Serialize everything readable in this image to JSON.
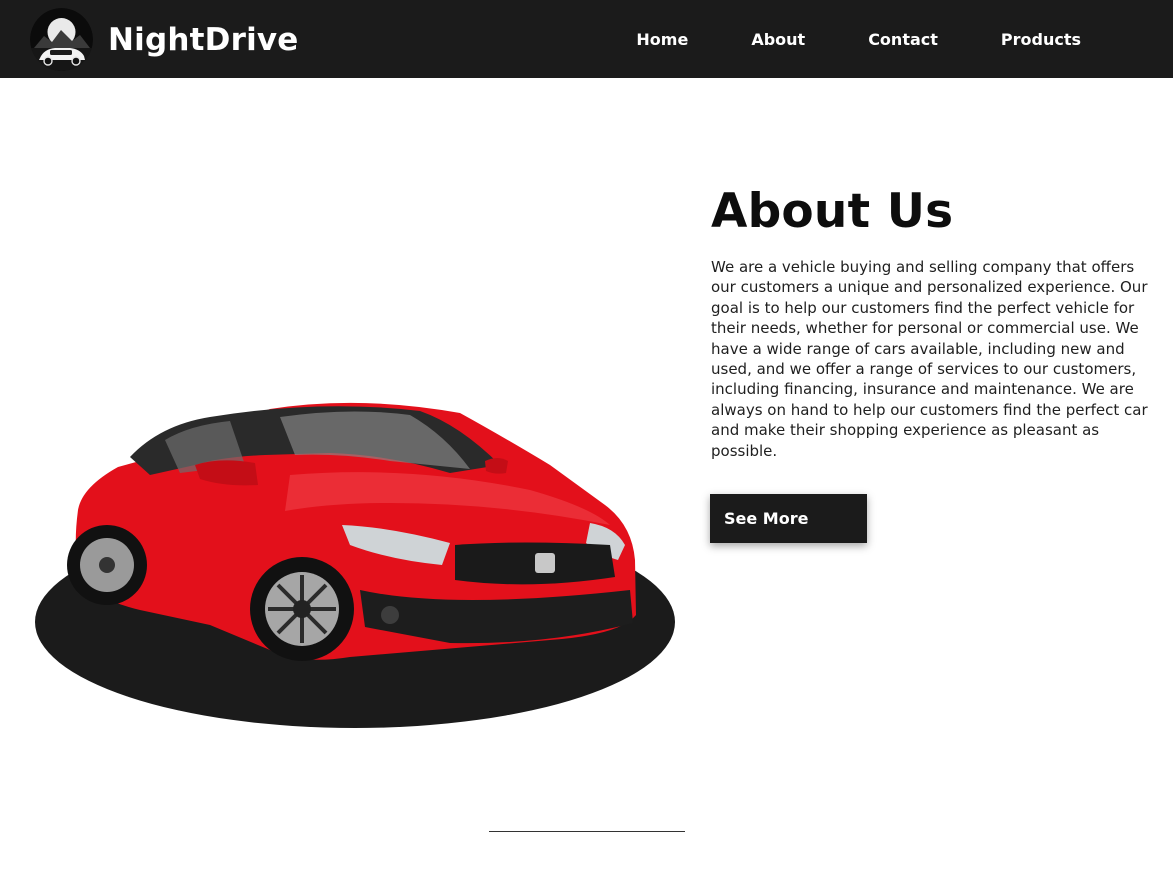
{
  "header": {
    "brand_name": "NightDrive",
    "nav": [
      {
        "label": "Home"
      },
      {
        "label": "About"
      },
      {
        "label": "Contact"
      },
      {
        "label": "Products"
      }
    ]
  },
  "about": {
    "title": "About Us",
    "body": "We are a vehicle buying and selling company that offers our customers a unique and personalized experience. Our goal is to help our customers find the perfect vehicle for their needs, whether for personal or commercial use. We have a wide range of cars available, including new and used, and we offer a range of services to our customers, including financing, insurance and maintenance. We are always on hand to help our customers find the perfect car and make their shopping experience as pleasant as possible.",
    "cta_label": "See More"
  },
  "icons": {
    "logo": "car-logo-icon",
    "hero": "red-car-illustration"
  },
  "colors": {
    "header_bg": "#1b1b1b",
    "car_red": "#e3101b",
    "button_bg": "#1b1b1b"
  }
}
